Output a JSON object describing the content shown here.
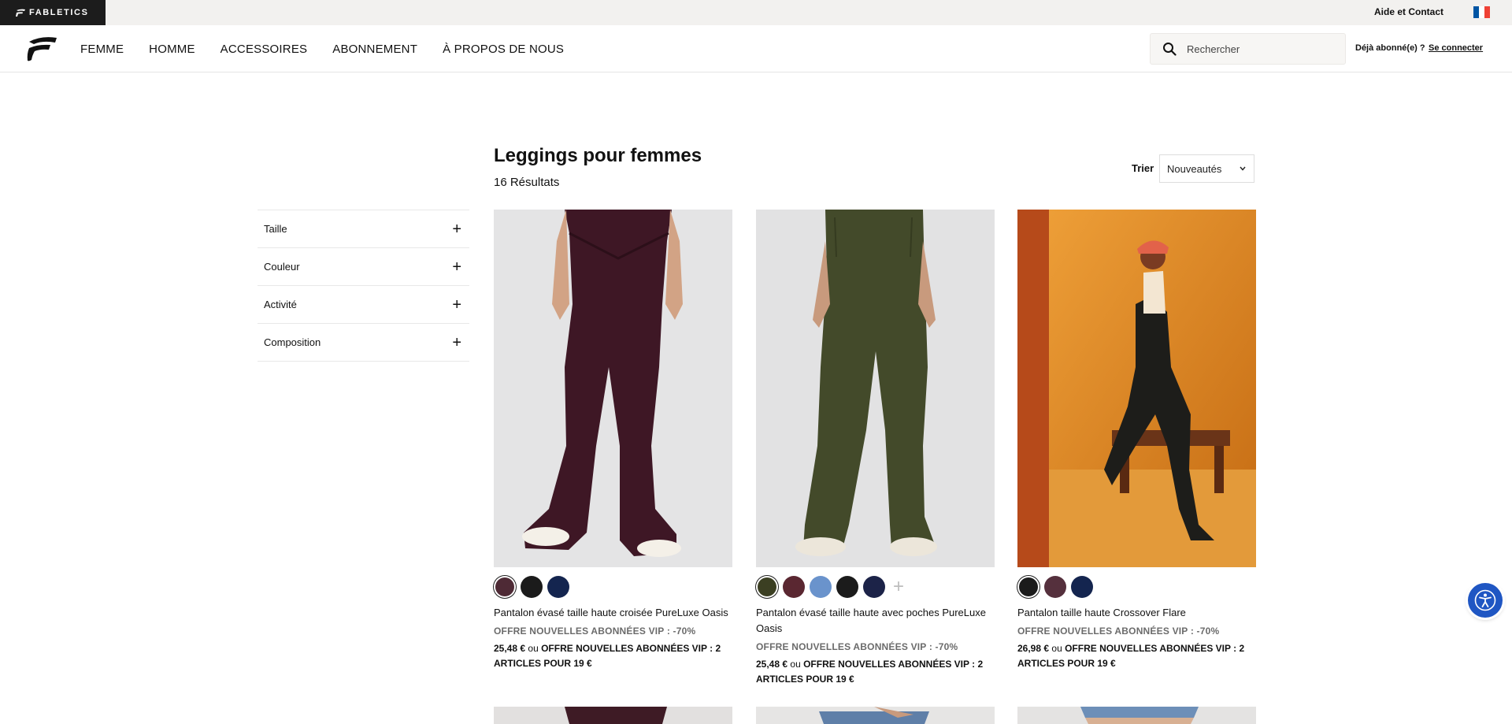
{
  "topbar": {
    "brand": "FABLETICS",
    "help_link": "Aide et Contact",
    "flag_colors": [
      "#0055A4",
      "#FFFFFF",
      "#EF4135"
    ]
  },
  "header": {
    "nav": [
      "FEMME",
      "HOMME",
      "ACCESSOIRES",
      "ABONNEMENT",
      "À PROPOS DE NOUS"
    ],
    "search_placeholder": "Rechercher",
    "member_text": "Déjà abonné(e) ?",
    "login_link": "Se connecter"
  },
  "filters": [
    {
      "label": "Taille",
      "icon": "plus-icon"
    },
    {
      "label": "Couleur",
      "icon": "plus-icon"
    },
    {
      "label": "Activité",
      "icon": "plus-icon"
    },
    {
      "label": "Composition",
      "icon": "plus-icon"
    }
  ],
  "listing": {
    "title": "Leggings pour femmes",
    "count": "16 Résultats",
    "sort_label": "Trier",
    "sort_value": "Nouveautés"
  },
  "products": [
    {
      "name": "Pantalon évasé taille haute croisée PureLuxe Oasis",
      "offer": "OFFRE NOUVELLES ABONNÉES VIP : -70%",
      "price": "25,48 €",
      "price_or": "ou",
      "price_offer": "OFFRE NOUVELLES ABONNÉES VIP : 2 ARTICLES POUR 19 €",
      "swatches": [
        "#4e2a35",
        "#1b1b1b",
        "#14254f"
      ],
      "selected_swatch": 0
    },
    {
      "name": "Pantalon évasé taille haute avec poches PureLuxe Oasis",
      "offer": "OFFRE NOUVELLES ABONNÉES VIP : -70%",
      "price": "25,48 €",
      "price_or": "ou",
      "price_offer": "OFFRE NOUVELLES ABONNÉES VIP : 2 ARTICLES POUR 19 €",
      "swatches": [
        "#3b3f22",
        "#5a2731",
        "#6a93cc",
        "#1b1b1b",
        "#1c2348"
      ],
      "selected_swatch": 0,
      "more": "+"
    },
    {
      "name": "Pantalon taille haute Crossover Flare",
      "offer": "OFFRE NOUVELLES ABONNÉES VIP : -70%",
      "price": "26,98 €",
      "price_or": "ou",
      "price_offer": "OFFRE NOUVELLES ABONNÉES VIP : 2 ARTICLES POUR 19 €",
      "swatches": [
        "#1b1b1b",
        "#55303d",
        "#14254f"
      ],
      "selected_swatch": 0
    }
  ],
  "colors": {
    "accent": "#1f56c3",
    "topbar_bg": "#f2f1ef"
  }
}
